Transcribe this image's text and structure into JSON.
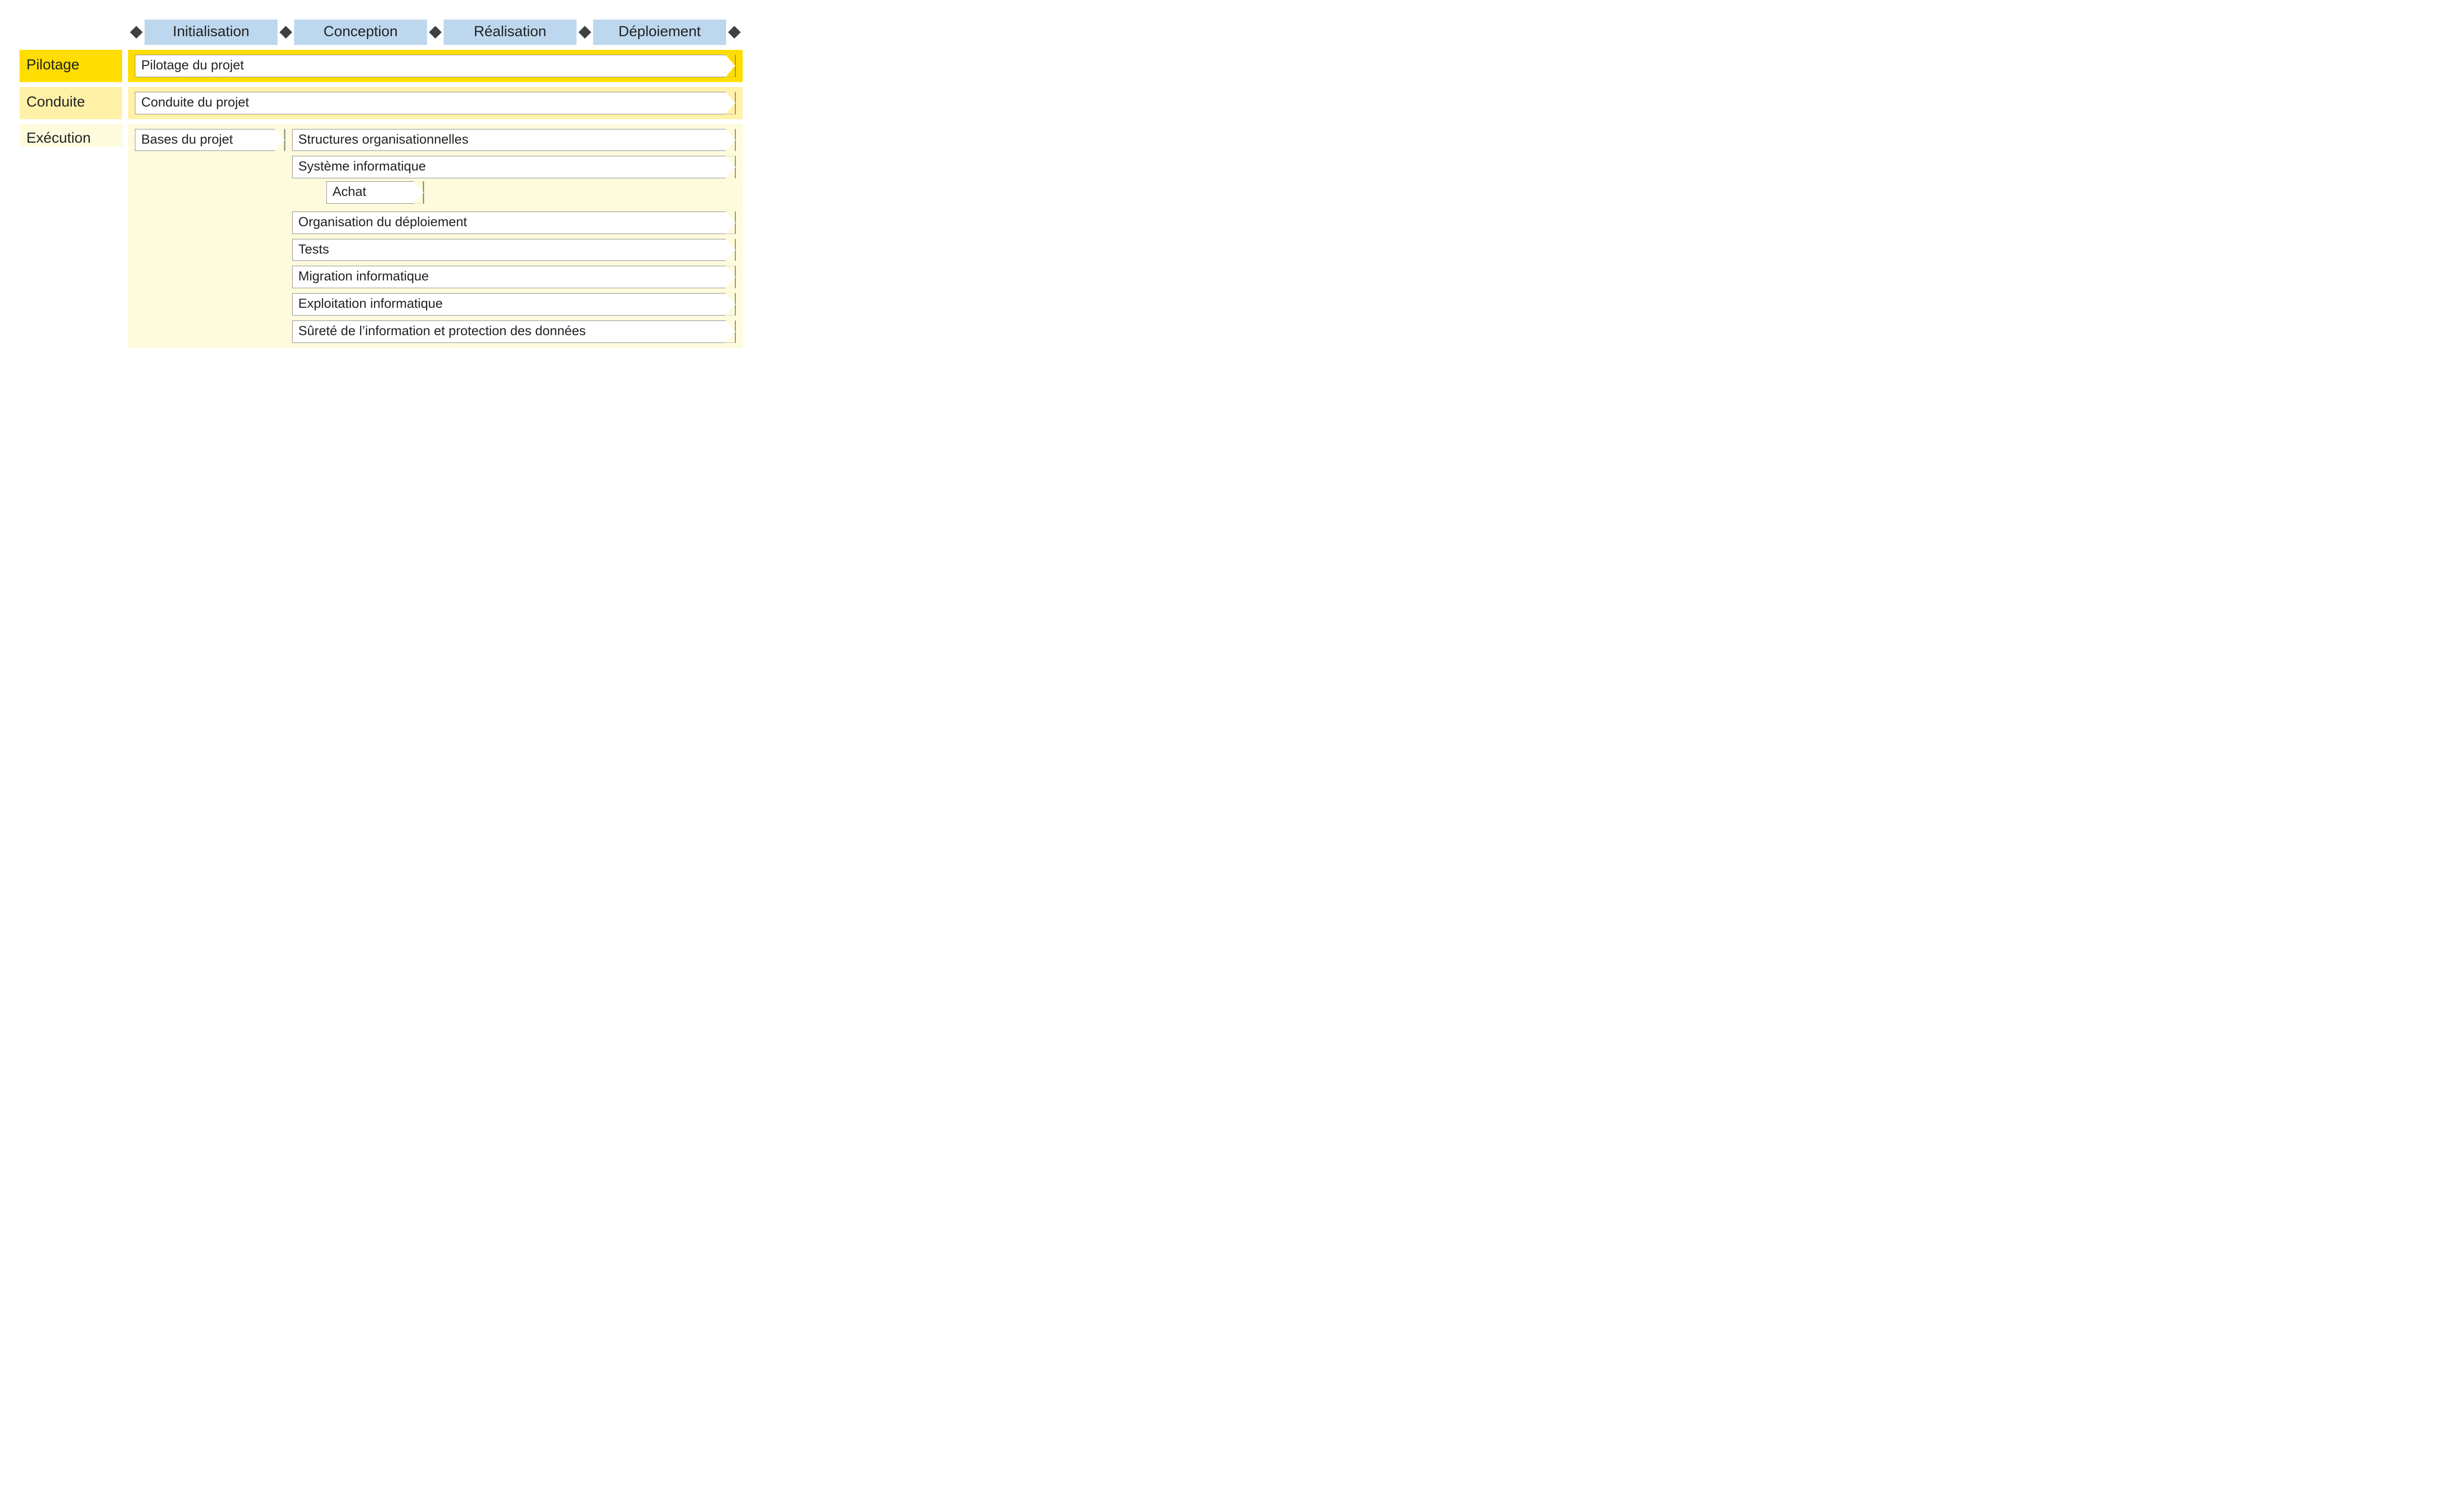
{
  "phases": {
    "p1": "Initialisation",
    "p2": "Conception",
    "p3": "Réalisation",
    "p4": "Déploiement"
  },
  "lanes": {
    "pilotage": {
      "label": "Pilotage",
      "bar": "Pilotage du projet"
    },
    "conduite": {
      "label": "Conduite",
      "bar": "Conduite du projet"
    },
    "execution": {
      "label": "Exécution",
      "bases": "Bases du projet",
      "items": {
        "structures": "Structures organisationnelles",
        "systeme": "Système informatique",
        "achat": "Achat",
        "organisation": "Organisation du déploiement",
        "tests": "Tests",
        "migration": "Migration informatique",
        "exploitation": "Exploitation informatique",
        "surete": "Sûreté de l’information et protection des données"
      }
    }
  }
}
